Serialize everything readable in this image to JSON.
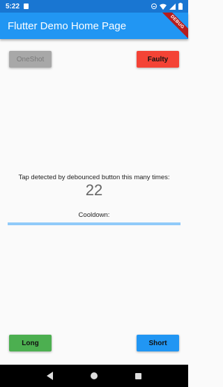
{
  "status_bar": {
    "time": "5:22"
  },
  "app_bar": {
    "title": "Flutter Demo Home Page",
    "debug_banner": "DEBUG"
  },
  "buttons": {
    "oneshot": "OneShot",
    "faulty": "Faulty",
    "long": "Long",
    "short": "Short"
  },
  "counter": {
    "label": "Tap detected by debounced button this many times:",
    "value": "22"
  },
  "cooldown": {
    "label": "Cooldown:",
    "progress": 1.0
  },
  "colors": {
    "primary": "#2196f3",
    "status_bar": "#1976d2",
    "faulty": "#f44336",
    "long": "#4caf50",
    "short": "#2196f3",
    "disabled": "#a8a8a8"
  }
}
